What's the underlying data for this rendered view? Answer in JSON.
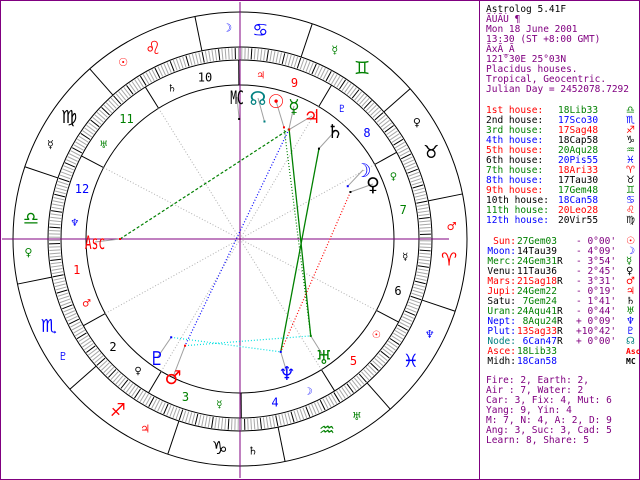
{
  "header": {
    "app_title": "Astrolog 5.41F",
    "name_line": "ÃÚÃÙ ¶",
    "date": "Mon 18 June 2001",
    "time": "13:30 (ST +8:00 GMT)",
    "place_line": "ÃxÃ_Ã",
    "coords": "121°30E 25°03N",
    "house_system": "Placidus houses.",
    "zodiac": "Tropical, Geocentric.",
    "julian_day": "Julian Day = 2452078.7292"
  },
  "colors": {
    "frame": "#800080",
    "fire": "#ff0000",
    "earth": "#000000",
    "air": "#008000",
    "water": "#0000ff",
    "node": "#008080"
  },
  "signs": [
    {
      "abbr": "Ari",
      "glyph": "♈",
      "ruler": "♂",
      "element": "fire"
    },
    {
      "abbr": "Tau",
      "glyph": "♉",
      "ruler": "♀",
      "element": "earth"
    },
    {
      "abbr": "Gem",
      "glyph": "♊",
      "ruler": "☿",
      "element": "air"
    },
    {
      "abbr": "Can",
      "glyph": "♋",
      "ruler": "☽",
      "element": "water"
    },
    {
      "abbr": "Leo",
      "glyph": "♌",
      "ruler": "☉",
      "element": "fire"
    },
    {
      "abbr": "Vir",
      "glyph": "♍",
      "ruler": "☿",
      "element": "earth"
    },
    {
      "abbr": "Lib",
      "glyph": "♎",
      "ruler": "♀",
      "element": "air"
    },
    {
      "abbr": "Sco",
      "glyph": "♏",
      "ruler": "♇",
      "element": "water"
    },
    {
      "abbr": "Sag",
      "glyph": "♐",
      "ruler": "♃",
      "element": "fire"
    },
    {
      "abbr": "Cap",
      "glyph": "♑",
      "ruler": "♄",
      "element": "earth"
    },
    {
      "abbr": "Aqu",
      "glyph": "♒",
      "ruler": "♅",
      "element": "air"
    },
    {
      "abbr": "Pis",
      "glyph": "♓",
      "ruler": "♆",
      "element": "water"
    }
  ],
  "houses": [
    {
      "num": "1",
      "label": "1st house:",
      "cusp": "18Lib33",
      "glyph": "♎",
      "ruler": "♂"
    },
    {
      "num": "2",
      "label": "2nd house:",
      "cusp": "17Sco30",
      "glyph": "♏",
      "ruler": "♀"
    },
    {
      "num": "3",
      "label": "3rd house:",
      "cusp": "17Sag48",
      "glyph": "♐",
      "ruler": "☿"
    },
    {
      "num": "4",
      "label": "4th house:",
      "cusp": "18Cap58",
      "glyph": "♑",
      "ruler": "☽"
    },
    {
      "num": "5",
      "label": "5th house:",
      "cusp": "20Aqu28",
      "glyph": "♒",
      "ruler": "☉"
    },
    {
      "num": "6",
      "label": "6th house:",
      "cusp": "20Pis55",
      "glyph": "♓",
      "ruler": "☿"
    },
    {
      "num": "7",
      "label": "7th house:",
      "cusp": "18Ari33",
      "glyph": "♈",
      "ruler": "♀"
    },
    {
      "num": "8",
      "label": "8th house:",
      "cusp": "17Tau30",
      "glyph": "♉",
      "ruler": "♇"
    },
    {
      "num": "9",
      "label": "9th house:",
      "cusp": "17Gem48",
      "glyph": "♊",
      "ruler": "♃"
    },
    {
      "num": "10",
      "label": "10th house:",
      "cusp": "18Can58",
      "glyph": "♋",
      "ruler": "♄"
    },
    {
      "num": "11",
      "label": "11th house:",
      "cusp": "20Leo28",
      "glyph": "♌",
      "ruler": "♅"
    },
    {
      "num": "12",
      "label": "12th house:",
      "cusp": "20Vir55",
      "glyph": "♍",
      "ruler": "♆"
    }
  ],
  "planets": [
    {
      "key": "sun",
      "label": "Sun:",
      "pos": "27Gem03",
      "retro": "",
      "lat": "- 0°00'",
      "glyph": "☉",
      "color": "#ff0000"
    },
    {
      "key": "moon",
      "label": "Moon:",
      "pos": "14Tau39",
      "retro": "",
      "lat": "- 4°09'",
      "glyph": "☽",
      "color": "#0000ff"
    },
    {
      "key": "merc",
      "label": "Merc:",
      "pos": "24Gem31",
      "retro": "R",
      "lat": "- 3°54'",
      "glyph": "☿",
      "color": "#008000"
    },
    {
      "key": "venu",
      "label": "Venu:",
      "pos": "11Tau36",
      "retro": "",
      "lat": "- 2°45'",
      "glyph": "♀",
      "color": "#000000"
    },
    {
      "key": "mars",
      "label": "Mars:",
      "pos": "21Sag18",
      "retro": "R",
      "lat": "- 3°31'",
      "glyph": "♂",
      "color": "#ff0000"
    },
    {
      "key": "jupi",
      "label": "Jupi:",
      "pos": "24Gem22",
      "retro": "",
      "lat": "- 0°19'",
      "glyph": "♃",
      "color": "#ff0000"
    },
    {
      "key": "satu",
      "label": "Satu:",
      "pos": "7Gem24",
      "retro": "",
      "lat": "- 1°41'",
      "glyph": "♄",
      "color": "#000000"
    },
    {
      "key": "uran",
      "label": "Uran:",
      "pos": "24Aqu41",
      "retro": "R",
      "lat": "- 0°44'",
      "glyph": "♅",
      "color": "#008000"
    },
    {
      "key": "nept",
      "label": "Nept:",
      "pos": "8Aqu24",
      "retro": "R",
      "lat": "+ 0°09'",
      "glyph": "♆",
      "color": "#0000ff"
    },
    {
      "key": "plut",
      "label": "Plut:",
      "pos": "13Sag33",
      "retro": "R",
      "lat": "+10°42'",
      "glyph": "♇",
      "color": "#0000ff"
    },
    {
      "key": "node",
      "label": "Node:",
      "pos": "6Can47",
      "retro": "R",
      "lat": "+ 0°00'",
      "glyph": "☊",
      "color": "#008080"
    },
    {
      "key": "asce",
      "label": "Asce:",
      "pos": "18Lib33",
      "retro": "",
      "lat": "",
      "glyph": "Asc",
      "color": "#ff0000"
    },
    {
      "key": "midh",
      "label": "Midh:",
      "pos": "18Can58",
      "retro": "",
      "lat": "",
      "glyph": "MC",
      "color": "#000000"
    }
  ],
  "aspects": [
    {
      "a": "asce",
      "b": "merc",
      "style": "dashed",
      "color": "#008000"
    },
    {
      "a": "merc",
      "b": "mars",
      "style": "dotted",
      "color": "#0000ff"
    },
    {
      "a": "jupi",
      "b": "uran",
      "style": "solid",
      "color": "#008000"
    },
    {
      "a": "sun",
      "b": "uran",
      "style": "dotted",
      "color": "#008000"
    },
    {
      "a": "satu",
      "b": "nept",
      "style": "solid",
      "color": "#008000"
    },
    {
      "a": "venu",
      "b": "nept",
      "style": "dotted",
      "color": "#ff0000"
    },
    {
      "a": "mars",
      "b": "uran",
      "style": "dotted",
      "color": "#00e0e0"
    },
    {
      "a": "plut",
      "b": "nept",
      "style": "dotted",
      "color": "#00e0e0"
    }
  ],
  "summary": [
    "Fire: 2, Earth: 2,",
    "Air : 7, Water: 2",
    "Car: 3, Fix: 4, Mut: 6",
    "Yang: 9, Yin: 4",
    "M: 7, N: 4, A: 2, D: 9",
    "Ang: 3, Suc: 3, Cad: 5",
    "Learn: 8, Share: 5"
  ]
}
